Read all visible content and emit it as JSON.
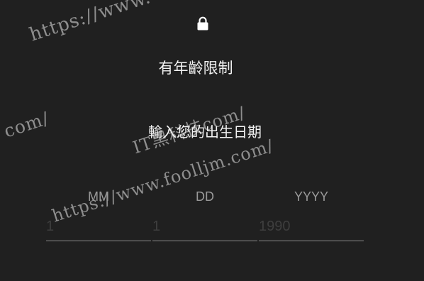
{
  "age_gate": {
    "title": "有年齡限制",
    "prompt": "輸入您的出生日期",
    "lock_icon": "lock-icon"
  },
  "birthdate": {
    "month": {
      "label": "MM",
      "placeholder": "1",
      "value": ""
    },
    "day": {
      "label": "DD",
      "placeholder": "1",
      "value": ""
    },
    "year": {
      "label": "YYYY",
      "placeholder": "1990",
      "value": ""
    }
  },
  "watermark": {
    "line1": "https://www.",
    "line2": "com/",
    "line3": "IT黑科技",
    "line4": "com/",
    "line5": "https://www.foolljm.com/"
  },
  "colors": {
    "background": "#202020",
    "text": "#f2f2f2",
    "label": "#9a9a9a",
    "placeholder": "#3e3e3e",
    "underline": "#8a8a8a"
  }
}
